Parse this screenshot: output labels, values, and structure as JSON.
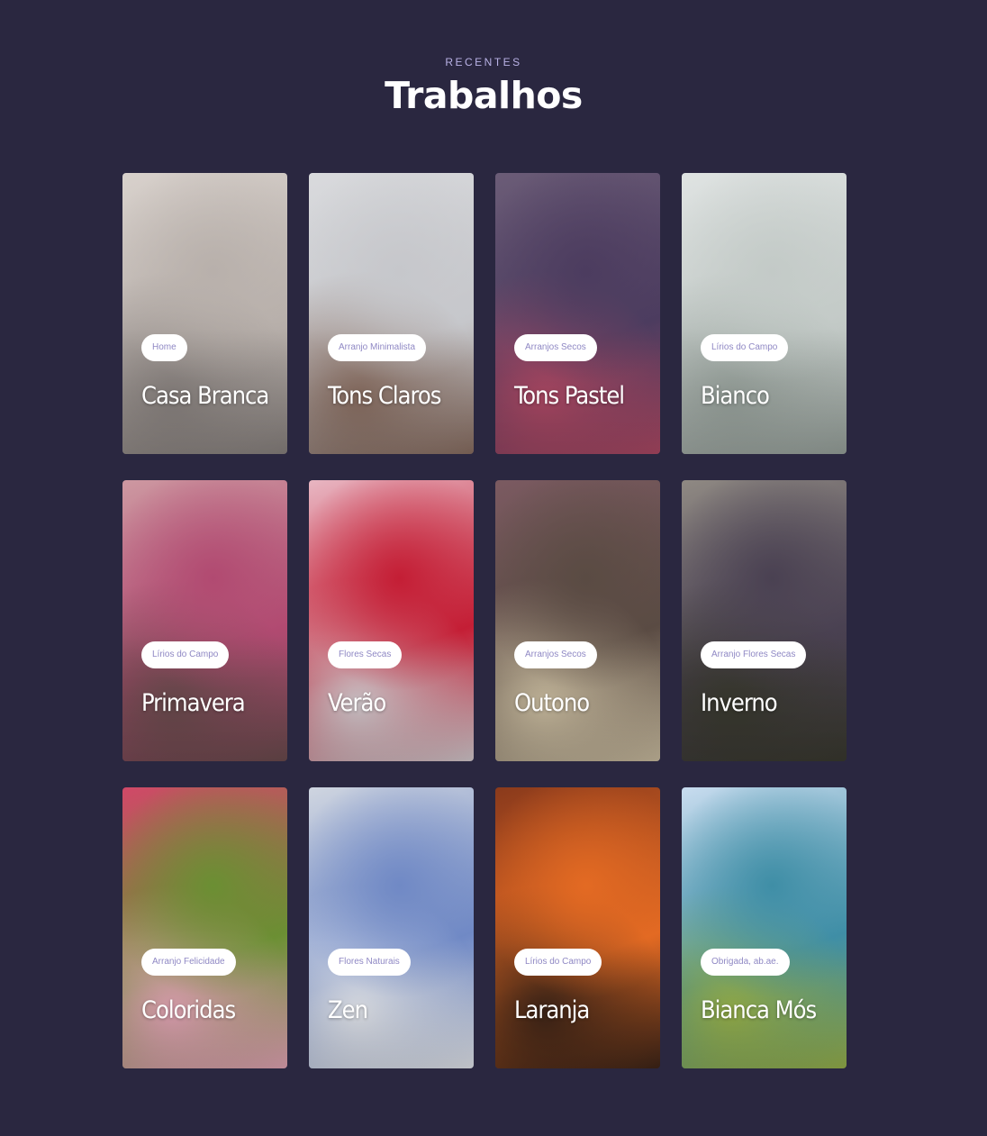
{
  "section": {
    "eyebrow": "RECENTES",
    "title": "Trabalhos"
  },
  "cards": [
    {
      "tag": "Home",
      "name": "Casa Branca",
      "colors": [
        "#d8d1cc",
        "#b8b0ab",
        "#8a8380"
      ]
    },
    {
      "tag": "Arranjo Minimalista",
      "name": "Tons Claros",
      "colors": [
        "#d9dadd",
        "#c6c7cb",
        "#8b6f62"
      ]
    },
    {
      "tag": "Arranjos Secos",
      "name": "Tons Pastel",
      "colors": [
        "#6b5c77",
        "#4c3c5f",
        "#b14a66"
      ]
    },
    {
      "tag": "Lírios do Campo",
      "name": "Bianco",
      "colors": [
        "#dfe3e2",
        "#c3cac7",
        "#9aa49e"
      ]
    },
    {
      "tag": "Lírios do Campo",
      "name": "Primavera",
      "colors": [
        "#cd98a1",
        "#b14a71",
        "#6b4c4e"
      ]
    },
    {
      "tag": "Flores Secas",
      "name": "Verão",
      "colors": [
        "#e8b6c2",
        "#c41e35",
        "#d8cfd3"
      ]
    },
    {
      "tag": "Arranjos Secos",
      "name": "Outono",
      "colors": [
        "#7b5a61",
        "#5a4b43",
        "#cfc1a4"
      ]
    },
    {
      "tag": "Arranjo Flores Secas",
      "name": "Inverno",
      "colors": [
        "#8f8983",
        "#4a4152",
        "#3a3a2f"
      ]
    },
    {
      "tag": "Arranjo Felicidade",
      "name": "Coloridas",
      "colors": [
        "#d14868",
        "#6b8f33",
        "#e7a7b9"
      ]
    },
    {
      "tag": "Flores Naturais",
      "name": "Zen",
      "colors": [
        "#cfd5e0",
        "#7089c5",
        "#e8ebf1"
      ]
    },
    {
      "tag": "Lírios do Campo",
      "name": "Laranja",
      "colors": [
        "#8a3a1c",
        "#e36a23",
        "#3e2518"
      ]
    },
    {
      "tag": "Obrigada, ab.ae.",
      "name": "Bianca Mós",
      "colors": [
        "#c8dcef",
        "#3f8ea6",
        "#9bb54b"
      ]
    }
  ]
}
